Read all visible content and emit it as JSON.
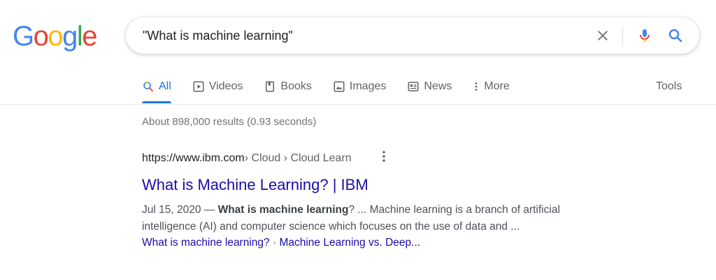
{
  "logo": {
    "letters": [
      "G",
      "o",
      "o",
      "g",
      "l",
      "e"
    ],
    "colors": [
      "#4285F4",
      "#EA4335",
      "#FBBC05",
      "#4285F4",
      "#34A853",
      "#EA4335"
    ]
  },
  "search": {
    "query": "\"What is machine learning\""
  },
  "tabs": [
    {
      "label": "All",
      "icon": "search-icon",
      "active": true
    },
    {
      "label": "Videos",
      "icon": "play-icon",
      "active": false
    },
    {
      "label": "Books",
      "icon": "book-icon",
      "active": false
    },
    {
      "label": "Images",
      "icon": "image-icon",
      "active": false
    },
    {
      "label": "News",
      "icon": "news-icon",
      "active": false
    },
    {
      "label": "More",
      "icon": "kebab-icon",
      "active": false
    }
  ],
  "tools_label": "Tools",
  "stats": "About 898,000 results (0.93 seconds)",
  "result": {
    "url": "https://www.ibm.com",
    "breadcrumb": " › Cloud › Cloud Learn",
    "title": "What is Machine Learning? | IBM",
    "date": "Jul 15, 2020 — ",
    "bold": "What is machine learning",
    "snippet_rest": "? ... Machine learning is a branch of artificial intelligence (AI) and computer science which focuses on the use of data and ...",
    "sitelinks": [
      "What is machine learning?",
      "Machine Learning vs. Deep..."
    ],
    "sitelink_separator": " · "
  },
  "colors": {
    "link": "#1a0dab",
    "active_tab": "#1a73e8",
    "muted": "#5f6368"
  }
}
